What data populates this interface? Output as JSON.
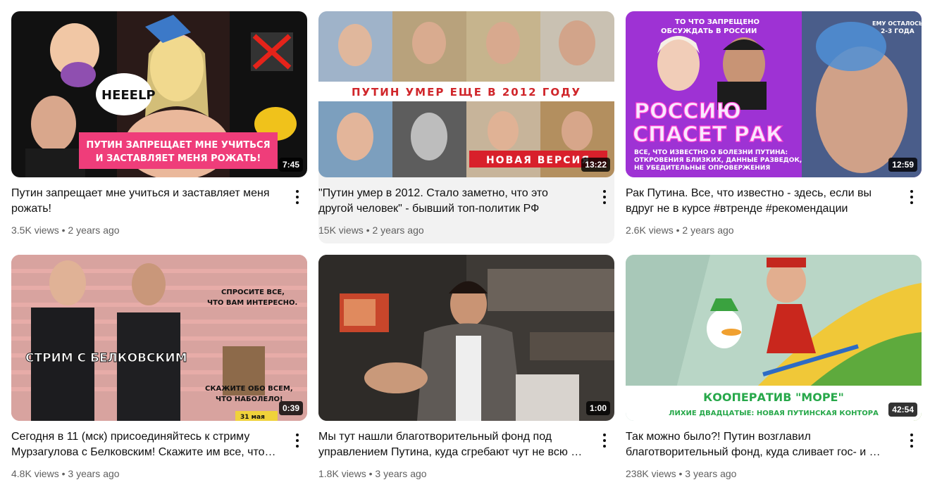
{
  "colors": {
    "accent_red": "#ff0000",
    "meta_gray": "#606060",
    "hover_bg": "#f2f2f2"
  },
  "videos": [
    {
      "title": "Путин запрещает мне учиться и заставляет меня рожать!",
      "views": "3.5K views",
      "age": "2 years ago",
      "duration": "7:45",
      "overlay": {
        "bubble": "HEEELP",
        "line1": "ПУТИН ЗАПРЕЩАЕТ МНЕ УЧИТЬСЯ",
        "line2": "И ЗАСТАВЛЯЕТ МЕНЯ РОЖАТЬ!"
      }
    },
    {
      "title": "\"Путин умер в 2012. Стало заметно, что это другой человек\" - бывший топ-политик РФ",
      "views": "15K views",
      "age": "2 years ago",
      "duration": "13:22",
      "overlay": {
        "banner": "ПУТИН УМЕР ЕЩЕ В 2012 ГОДУ",
        "tag": "НОВАЯ ВЕРСИЯ"
      }
    },
    {
      "title": "Рак Путина. Все, что известно - здесь, если вы вдруг не в курсе #втренде #рекомендации",
      "views": "2.6K views",
      "age": "2 years ago",
      "duration": "12:59",
      "overlay": {
        "top1": "ТО ЧТО ЗАПРЕЩЕНО",
        "top2": "ОБСУЖДАТЬ В РОССИИ",
        "corner1": "ЕМУ ОСТАЛОСЬ",
        "corner2": "2-3 ГОДА",
        "big1": "РОССИЮ",
        "big2": "СПАСЕТ РАК",
        "sub1": "ВСЕ, ЧТО ИЗВЕСТНО О БОЛЕЗНИ ПУТИНА:",
        "sub2": "ОТКРОВЕНИЯ БЛИЗКИХ, ДАННЫЕ РАЗВЕДОК,",
        "sub3": "НЕ УБЕДИТЕЛЬНЫЕ ОПРОВЕРЖЕНИЯ"
      }
    },
    {
      "title": "Сегодня в 11 (мск) присоединяйтесь к стриму Мурзагулова с Белковским! Скажите им все, что …",
      "views": "4.8K views",
      "age": "3 years ago",
      "duration": "0:39",
      "overlay": {
        "q1": "СПРОСИТЕ ВСЕ,",
        "q2": "ЧТО ВАМ ИНТЕРЕСНО.",
        "main": "СТРИМ С БЕЛКОВСКИМ",
        "s1": "СКАЖИТЕ ОБО ВСЕМ,",
        "s2": "ЧТО НАБОЛЕЛО!",
        "date": "31 мая"
      }
    },
    {
      "title": "Мы тут нашли благотворительный фонд под управлением Путина, куда сгребают чут не всю …",
      "views": "1.8K views",
      "age": "3 years ago",
      "duration": "1:00",
      "overlay": {}
    },
    {
      "title": "Так можно было?! Путин возглавил благотворительный фонд, куда сливает гос- и …",
      "views": "238K views",
      "age": "3 years ago",
      "duration": "42:54",
      "overlay": {
        "coop": "КООПЕРАТИВ \"МОРЕ\"",
        "sub": "ЛИХИЕ ДВАДЦАТЫЕ: НОВАЯ ПУТИНСКАЯ КОНТОРА"
      }
    }
  ]
}
